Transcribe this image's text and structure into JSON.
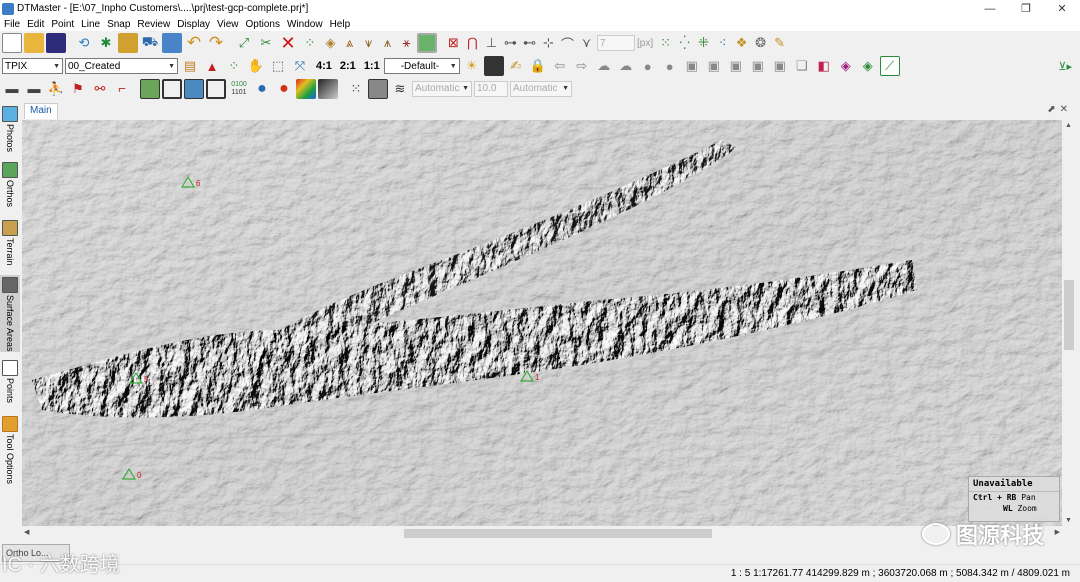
{
  "window": {
    "title": "DTMaster - [E:\\07_Inpho Customers\\....\\prj\\test-gcp-complete.prj*]",
    "minimize": "—",
    "restore": "❐",
    "close": "✕"
  },
  "menu": [
    "File",
    "Edit",
    "Point",
    "Line",
    "Snap",
    "Review",
    "Display",
    "View",
    "Options",
    "Window",
    "Help"
  ],
  "toolbar1": {
    "spin_value": "7",
    "unit_label": "[px]"
  },
  "toolbar2": {
    "layer_combo": "TPIX",
    "status_combo": "00_Created",
    "ratio_4_1": "4:1",
    "ratio_2_1": "2:1",
    "ratio_1_1": "1:1",
    "display_combo": "-Default-"
  },
  "toolbar3": {
    "binary_top": "0100",
    "binary_bottom": "1101",
    "auto_combo_1": "Automatic",
    "value_field": "10.0",
    "auto_combo_2": "Automatic"
  },
  "tabs": {
    "main": "Main"
  },
  "sidebar": [
    {
      "label": "Photos",
      "icon": "photos-icon"
    },
    {
      "label": "Orthos",
      "icon": "orthos-icon"
    },
    {
      "label": "Terrain",
      "icon": "terrain-icon"
    },
    {
      "label": "Surface Areas",
      "icon": "surface-areas-icon"
    },
    {
      "label": "Points",
      "icon": "points-icon"
    },
    {
      "label": "Tool Options",
      "icon": "tool-options-icon"
    }
  ],
  "gcp_points": [
    {
      "id": "6"
    },
    {
      "id": "5"
    },
    {
      "id": "1"
    },
    {
      "id": "0"
    }
  ],
  "map_legend": {
    "heading": "Unavailable",
    "row1_key": "Ctrl + RB",
    "row1_action": "Pan",
    "row2_key": "WL",
    "row2_action": "Zoom"
  },
  "bottom_tab": "Ortho Lo...",
  "status": {
    "coords": "1 : 5  1:17261.77  414299.829 m ; 3603720.068 m ; 5084.342 m / 4809.021 m"
  },
  "watermarks": {
    "right": "图源科技",
    "left": "IC · 六数跨境"
  },
  "colors": {
    "gcp_marker": "#3caa3c",
    "gcp_label": "#cc2222",
    "tab_text": "#1a5aa8"
  }
}
